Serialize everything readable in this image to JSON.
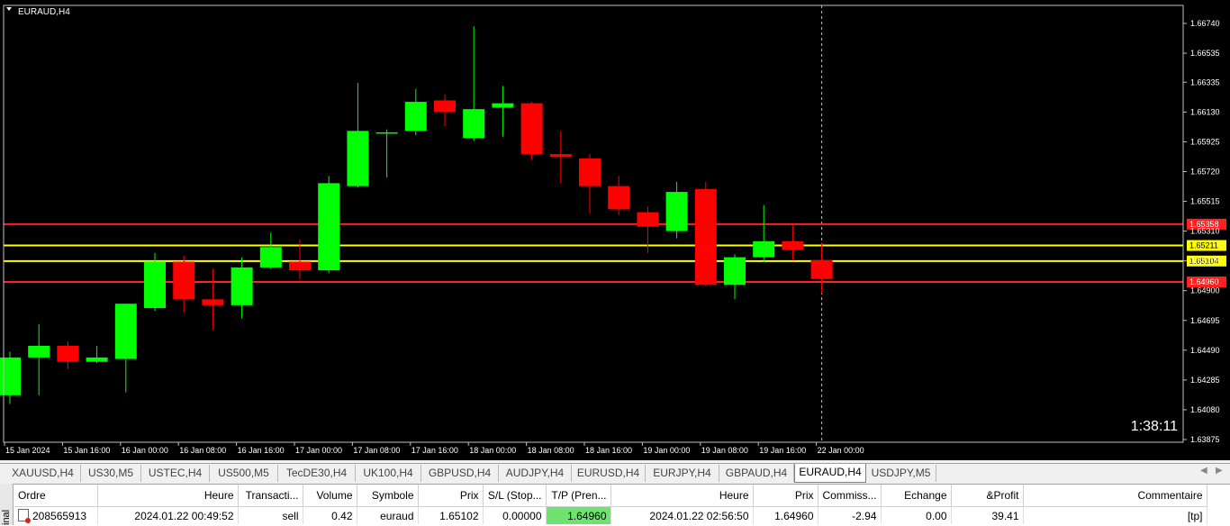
{
  "window": {
    "title": "EURAUD,H4"
  },
  "chart_data": {
    "type": "candlestick",
    "symbol": "EURAUD",
    "timeframe": "H4",
    "ylim": [
      1.63875,
      1.6684
    ],
    "y_ticks": [
      "1.66740",
      "1.66535",
      "1.66335",
      "1.66130",
      "1.65925",
      "1.65720",
      "1.65515",
      "1.65310",
      "1.65105",
      "1.64900",
      "1.64695",
      "1.64490",
      "1.64285",
      "1.64080",
      "1.63875"
    ],
    "x_ticks": [
      "15 Jan 2024",
      "15 Jan 16:00",
      "16 Jan 00:00",
      "16 Jan 08:00",
      "16 Jan 16:00",
      "17 Jan 00:00",
      "17 Jan 08:00",
      "17 Jan 16:00",
      "18 Jan 00:00",
      "18 Jan 08:00",
      "18 Jan 16:00",
      "19 Jan 00:00",
      "19 Jan 08:00",
      "19 Jan 16:00",
      "22 Jan 00:00"
    ],
    "candles": [
      {
        "o": 1.6418,
        "h": 1.6448,
        "l": 1.6412,
        "c": 1.6444
      },
      {
        "o": 1.6444,
        "h": 1.6467,
        "l": 1.6418,
        "c": 1.6452
      },
      {
        "o": 1.6452,
        "h": 1.6455,
        "l": 1.6436,
        "c": 1.6441
      },
      {
        "o": 1.6441,
        "h": 1.6452,
        "l": 1.644,
        "c": 1.6444
      },
      {
        "o": 1.6443,
        "h": 1.6481,
        "l": 1.642,
        "c": 1.6481
      },
      {
        "o": 1.6478,
        "h": 1.6516,
        "l": 1.6476,
        "c": 1.651
      },
      {
        "o": 1.651,
        "h": 1.6514,
        "l": 1.6475,
        "c": 1.6484
      },
      {
        "o": 1.6484,
        "h": 1.6505,
        "l": 1.6463,
        "c": 1.648
      },
      {
        "o": 1.648,
        "h": 1.6513,
        "l": 1.6471,
        "c": 1.6506
      },
      {
        "o": 1.6506,
        "h": 1.653,
        "l": 1.6505,
        "c": 1.652
      },
      {
        "o": 1.651,
        "h": 1.6525,
        "l": 1.6498,
        "c": 1.6504
      },
      {
        "o": 1.6504,
        "h": 1.6569,
        "l": 1.6502,
        "c": 1.6564
      },
      {
        "o": 1.6562,
        "h": 1.6633,
        "l": 1.6561,
        "c": 1.66
      },
      {
        "o": 1.6599,
        "h": 1.6601,
        "l": 1.6568,
        "c": 1.6599
      },
      {
        "o": 1.66,
        "h": 1.6629,
        "l": 1.6597,
        "c": 1.662
      },
      {
        "o": 1.6621,
        "h": 1.6625,
        "l": 1.6603,
        "c": 1.6613
      },
      {
        "o": 1.6595,
        "h": 1.6672,
        "l": 1.6593,
        "c": 1.6615
      },
      {
        "o": 1.6616,
        "h": 1.6631,
        "l": 1.6596,
        "c": 1.6619
      },
      {
        "o": 1.6619,
        "h": 1.662,
        "l": 1.658,
        "c": 1.6584
      },
      {
        "o": 1.6584,
        "h": 1.66,
        "l": 1.6564,
        "c": 1.6582
      },
      {
        "o": 1.6581,
        "h": 1.6584,
        "l": 1.6543,
        "c": 1.6562
      },
      {
        "o": 1.6562,
        "h": 1.6569,
        "l": 1.6542,
        "c": 1.6546
      },
      {
        "o": 1.6544,
        "h": 1.6548,
        "l": 1.6516,
        "c": 1.6534
      },
      {
        "o": 1.6531,
        "h": 1.6565,
        "l": 1.6526,
        "c": 1.6558
      },
      {
        "o": 1.656,
        "h": 1.6565,
        "l": 1.6493,
        "c": 1.6494
      },
      {
        "o": 1.6494,
        "h": 1.6515,
        "l": 1.6484,
        "c": 1.6513
      },
      {
        "o": 1.6513,
        "h": 1.6549,
        "l": 1.651,
        "c": 1.6524
      },
      {
        "o": 1.6524,
        "h": 1.6535,
        "l": 1.6511,
        "c": 1.6518
      },
      {
        "o": 1.6511,
        "h": 1.6523,
        "l": 1.6488,
        "c": 1.6498
      }
    ],
    "price_lines": [
      {
        "value": 1.65358,
        "label": "1.65358",
        "color": "#ff2020"
      },
      {
        "value": 1.65211,
        "label": "1.65211",
        "color": "#ffff00"
      },
      {
        "value": 1.65104,
        "label": "1.65104",
        "color": "#ffff00"
      },
      {
        "value": 1.6496,
        "label": "1.64960",
        "color": "#ff2020"
      }
    ],
    "bull_color": "#00ff00",
    "bear_color": "#ff0000",
    "timer": "1:38:11",
    "grid": false
  },
  "tabs": [
    {
      "label": "XAUUSD,H4",
      "active": false
    },
    {
      "label": "US30,M5",
      "active": false
    },
    {
      "label": "USTEC,H4",
      "active": false
    },
    {
      "label": "US500,M5",
      "active": false
    },
    {
      "label": "TecDE30,H4",
      "active": false
    },
    {
      "label": "UK100,H4",
      "active": false
    },
    {
      "label": "GBPUSD,H4",
      "active": false
    },
    {
      "label": "AUDJPY,H4",
      "active": false
    },
    {
      "label": "EURUSD,H4",
      "active": false
    },
    {
      "label": "EURJPY,H4",
      "active": false
    },
    {
      "label": "GBPAUD,H4",
      "active": false
    },
    {
      "label": "EURAUD,H4",
      "active": true
    },
    {
      "label": "USDJPY,M5",
      "active": false
    }
  ],
  "terminal": {
    "side_label": "inal",
    "columns": [
      "Ordre",
      "Heure",
      "Transacti...",
      "Volume",
      "Symbole",
      "Prix",
      "S/L (Stop...",
      "T/P (Pren...",
      "Heure",
      "Prix",
      "Commiss...",
      "Echange",
      "&Profit",
      "Commentaire"
    ],
    "rows": [
      [
        "208565913",
        "2024.01.22 00:49:52",
        "sell",
        "0.42",
        "euraud",
        "1.65102",
        "0.00000",
        "1.64960",
        "2024.01.22 02:56:50",
        "1.64960",
        "-2.94",
        "0.00",
        "39.41",
        "[tp]"
      ]
    ]
  }
}
